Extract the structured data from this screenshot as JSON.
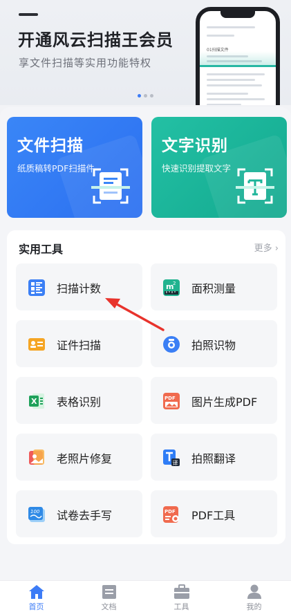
{
  "banner": {
    "title": "开通风云扫描王会员",
    "subtitle": "享文件扫描等实用功能特权",
    "phone_doc_title": "01扫描文件",
    "carousel": {
      "count": 3,
      "active_index": 0
    }
  },
  "features": [
    {
      "title": "文件扫描",
      "subtitle": "纸质稿转PDF扫描件",
      "icon": "document-scan-icon",
      "color": "#3a86f7"
    },
    {
      "title": "文字识别",
      "subtitle": "快速识别提取文字",
      "icon": "text-recognition-icon",
      "color": "#1db59a"
    }
  ],
  "tools": {
    "title": "实用工具",
    "more_label": "更多",
    "items": [
      {
        "label": "扫描计数",
        "icon": "scan-count-icon"
      },
      {
        "label": "面积测量",
        "icon": "area-measure-icon"
      },
      {
        "label": "证件扫描",
        "icon": "id-card-scan-icon"
      },
      {
        "label": "拍照识物",
        "icon": "photo-identify-icon"
      },
      {
        "label": "表格识别",
        "icon": "excel-table-icon"
      },
      {
        "label": "图片生成PDF",
        "icon": "image-to-pdf-icon"
      },
      {
        "label": "老照片修复",
        "icon": "photo-restore-icon"
      },
      {
        "label": "拍照翻译",
        "icon": "photo-translate-icon"
      },
      {
        "label": "试卷去手写",
        "icon": "exam-remove-handwriting-icon"
      },
      {
        "label": "PDF工具",
        "icon": "pdf-tools-icon"
      }
    ]
  },
  "nav": {
    "items": [
      {
        "label": "首页",
        "icon": "home-icon",
        "active": true
      },
      {
        "label": "文档",
        "icon": "document-icon",
        "active": false
      },
      {
        "label": "工具",
        "icon": "toolbox-icon",
        "active": false
      },
      {
        "label": "我的",
        "icon": "user-icon",
        "active": false
      }
    ],
    "active_color": "#3d7cf6"
  },
  "annotation": {
    "arrow_color": "#e8332c",
    "points_to": "扫描计数"
  }
}
